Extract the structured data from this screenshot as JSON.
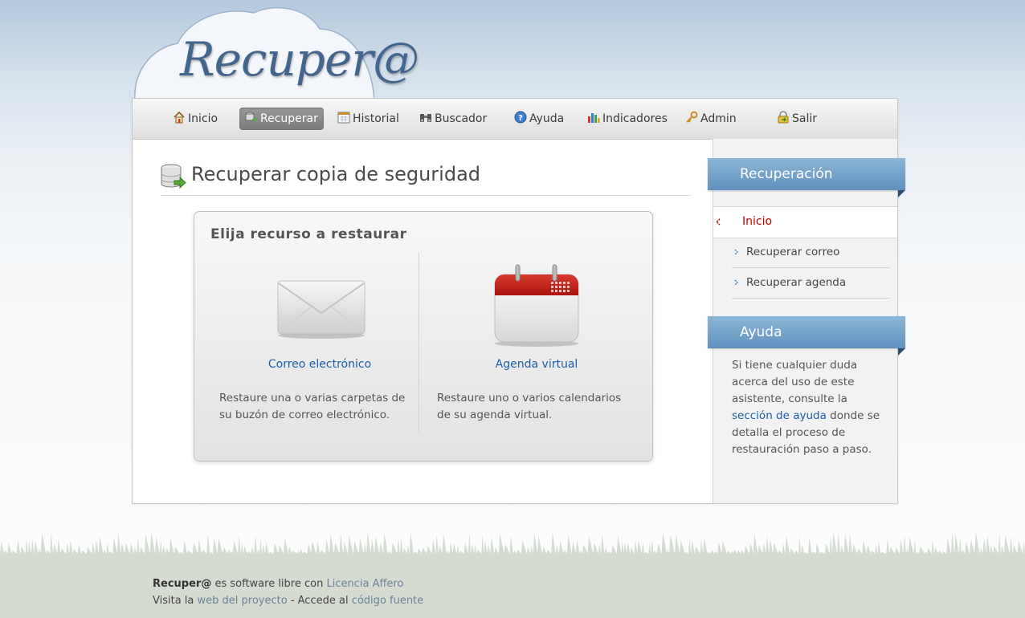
{
  "app": {
    "logo_text": "Recuper@"
  },
  "nav": {
    "items": [
      {
        "label": "Inicio",
        "icon": "home-icon"
      },
      {
        "label": "Recuperar",
        "icon": "database-restore-icon",
        "active": true
      },
      {
        "label": "Historial",
        "icon": "calendar-grid-icon"
      },
      {
        "label": "Buscador",
        "icon": "binoculars-icon"
      },
      {
        "label": "Ayuda",
        "icon": "help-circle-icon"
      },
      {
        "label": "Indicadores",
        "icon": "bar-chart-icon"
      },
      {
        "label": "Admin",
        "icon": "key-icon"
      },
      {
        "label": "Salir",
        "icon": "lock-exit-icon"
      }
    ]
  },
  "main": {
    "title": "Recuperar copia de seguridad",
    "panel_title": "Elija recurso a restaurar",
    "options": [
      {
        "link": "Correo electrónico",
        "desc": "Restaure una o varias carpetas de su buzón de correo electrónico.",
        "icon": "envelope-icon"
      },
      {
        "link": "Agenda virtual",
        "desc": "Restaure uno o varios calendarios de su agenda virtual.",
        "icon": "calendar-icon"
      }
    ]
  },
  "sidebar": {
    "section1_title": "Recuperación",
    "current": "Inicio",
    "items": [
      "Recuperar correo",
      "Recuperar agenda"
    ],
    "section2_title": "Ayuda",
    "help_before": "Si tiene cualquier duda acerca del uso de este asistente, consulte la ",
    "help_link": "sección de ayuda",
    "help_after": " donde se detalla el proceso de restauración paso a paso."
  },
  "footer": {
    "brand": "Recuper@",
    "line1_text": " es software libre con ",
    "line1_link": "Licencia Affero",
    "line2_prefix": "Visita la ",
    "line2_link1": "web del proyecto",
    "line2_mid": " - Accede al ",
    "line2_link2": "código fuente"
  },
  "colors": {
    "accent_link": "#1a5fa8",
    "current_item": "#c00000",
    "ribbon": "#6d9cc6",
    "footer_bg": "#d6dbd1"
  }
}
